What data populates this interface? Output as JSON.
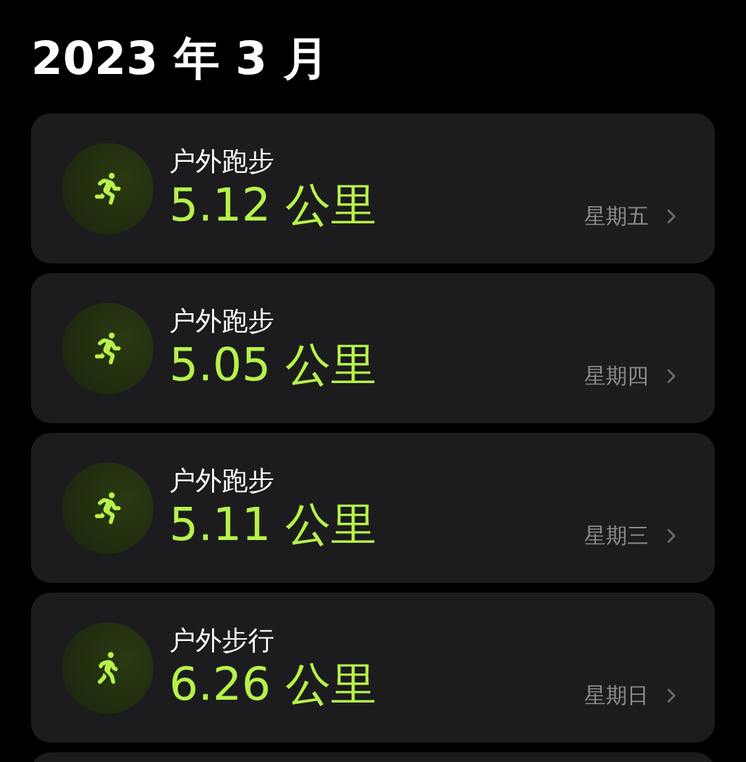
{
  "header": {
    "title": "2023 年 3 月"
  },
  "workouts": [
    {
      "kind": "run",
      "name": "户外跑步",
      "distance": "5.12 公里",
      "day": "星期五"
    },
    {
      "kind": "run",
      "name": "户外跑步",
      "distance": "5.05 公里",
      "day": "星期四"
    },
    {
      "kind": "run",
      "name": "户外跑步",
      "distance": "5.11 公里",
      "day": "星期三"
    },
    {
      "kind": "walk",
      "name": "户外步行",
      "distance": "6.26 公里",
      "day": "星期日"
    }
  ]
}
